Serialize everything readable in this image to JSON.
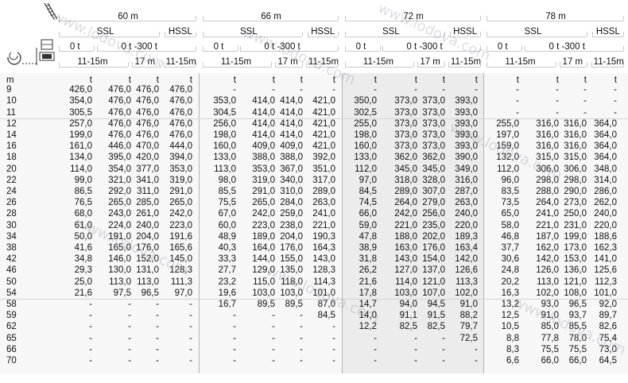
{
  "header": {
    "groups": [
      {
        "label": "60 m",
        "ssl": "SSL",
        "hssl": "HSSL",
        "ballast_a": "0 t",
        "ballast_b": "0 t -300 t",
        "r1": "11-15m",
        "r2": "17 m",
        "r3": "11-15m"
      },
      {
        "label": "66 m",
        "ssl": "SSL",
        "hssl": "HSSL",
        "ballast_a": "0 t",
        "ballast_b": "0 t -300 t",
        "r1": "11-15m",
        "r2": "17 m",
        "r3": "11-15m"
      },
      {
        "label": "72 m",
        "ssl": "SSL",
        "hssl": "HSSL",
        "ballast_a": "0 t",
        "ballast_b": "0 t -300 t",
        "r1": "11-15m",
        "r2": "17 m",
        "r3": "11-15m"
      },
      {
        "label": "78 m",
        "ssl": "SSL",
        "hssl": "HSSL",
        "ballast_a": "0 t",
        "ballast_b": "0 t -300 t",
        "r1": "11-15m",
        "r2": "17 m",
        "r3": "11-15m"
      }
    ]
  },
  "unit_row": {
    "m": "m",
    "t": "t"
  },
  "rows": [
    {
      "m": "9",
      "v": [
        "426,0",
        "476,0",
        "476,0",
        "476,0",
        "-",
        "-",
        "-",
        "-",
        "-",
        "-",
        "-",
        "-",
        "-",
        "-",
        "-",
        "-"
      ]
    },
    {
      "m": "10",
      "v": [
        "354,0",
        "476,0",
        "476,0",
        "476,0",
        "353,0",
        "414,0",
        "414,0",
        "421,0",
        "350,0",
        "373,0",
        "373,0",
        "393,0",
        "-",
        "-",
        "-",
        "-"
      ]
    },
    {
      "m": "11",
      "v": [
        "305,5",
        "476,0",
        "476,0",
        "476,0",
        "304,5",
        "414,0",
        "414,0",
        "421,0",
        "302,5",
        "373,0",
        "373,0",
        "393,0",
        "-",
        "-",
        "-",
        "-"
      ]
    },
    {
      "m": "12",
      "v": [
        "257,0",
        "476,0",
        "476,0",
        "476,0",
        "256,0",
        "414,0",
        "414,0",
        "421,0",
        "255,0",
        "373,0",
        "373,0",
        "393,0",
        "255,0",
        "316,0",
        "316,0",
        "364,0"
      ]
    },
    {
      "m": "14",
      "v": [
        "199,0",
        "476,0",
        "476,0",
        "476,0",
        "198,0",
        "414,0",
        "414,0",
        "421,0",
        "198,0",
        "373,0",
        "373,0",
        "393,0",
        "197,0",
        "316,0",
        "316,0",
        "364,0"
      ]
    },
    {
      "m": "16",
      "v": [
        "161,0",
        "446,0",
        "470,0",
        "444,0",
        "160,0",
        "409,0",
        "409,0",
        "421,0",
        "160,0",
        "373,0",
        "373,0",
        "393,0",
        "159,0",
        "316,0",
        "316,0",
        "364,0"
      ]
    },
    {
      "m": "18",
      "v": [
        "134,0",
        "395,0",
        "420,0",
        "394,0",
        "133,0",
        "388,0",
        "388,0",
        "392,0",
        "133,0",
        "362,0",
        "362,0",
        "390,0",
        "132,0",
        "315,0",
        "315,0",
        "364,0"
      ]
    },
    {
      "m": "20",
      "v": [
        "114,0",
        "354,0",
        "377,0",
        "353,0",
        "113,0",
        "353,0",
        "367,0",
        "351,0",
        "112,0",
        "345,0",
        "345,0",
        "349,0",
        "112,0",
        "306,0",
        "306,0",
        "348,0"
      ]
    },
    {
      "m": "22",
      "v": [
        "99,0",
        "321,0",
        "341,0",
        "319,0",
        "98,0",
        "319,0",
        "340,0",
        "317,0",
        "97,0",
        "318,0",
        "328,0",
        "316,0",
        "96,0",
        "298,0",
        "298,0",
        "314,0"
      ]
    },
    {
      "m": "24",
      "v": [
        "86,5",
        "292,0",
        "311,0",
        "291,0",
        "85,5",
        "291,0",
        "310,0",
        "289,0",
        "84,5",
        "289,0",
        "307,0",
        "287,0",
        "83,5",
        "288,0",
        "290,0",
        "286,0"
      ]
    },
    {
      "m": "26",
      "v": [
        "76,5",
        "265,0",
        "285,0",
        "265,0",
        "75,5",
        "265,0",
        "284,0",
        "263,0",
        "74,5",
        "264,0",
        "279,0",
        "263,0",
        "73,5",
        "264,0",
        "273,0",
        "262,0"
      ]
    },
    {
      "m": "28",
      "v": [
        "68,0",
        "243,0",
        "261,0",
        "242,0",
        "67,0",
        "242,0",
        "259,0",
        "241,0",
        "66,0",
        "242,0",
        "256,0",
        "240,0",
        "65,0",
        "241,0",
        "250,0",
        "240,0"
      ]
    },
    {
      "m": "30",
      "v": [
        "61,0",
        "224,0",
        "240,0",
        "223,0",
        "60,0",
        "223,0",
        "238,0",
        "221,0",
        "59,0",
        "221,0",
        "235,0",
        "220,0",
        "58,0",
        "221,0",
        "231,0",
        "220,0"
      ]
    },
    {
      "m": "34",
      "v": [
        "50,0",
        "191,0",
        "204,0",
        "191,6",
        "48,9",
        "189,0",
        "204,0",
        "190,3",
        "47,8",
        "188,0",
        "202,0",
        "189,3",
        "46,8",
        "187,0",
        "199,0",
        "188,6"
      ]
    },
    {
      "m": "38",
      "v": [
        "41,6",
        "165,0",
        "176,0",
        "165,6",
        "40,3",
        "164,0",
        "176,0",
        "164,3",
        "38,9",
        "163,0",
        "176,0",
        "163,4",
        "37,7",
        "162,0",
        "173,0",
        "162,3"
      ]
    },
    {
      "m": "42",
      "v": [
        "34,8",
        "146,0",
        "152,0",
        "145,0",
        "33,3",
        "144,0",
        "155,0",
        "143,0",
        "31,8",
        "143,0",
        "154,0",
        "142,0",
        "30,6",
        "142,0",
        "153,0",
        "141,0"
      ]
    },
    {
      "m": "46",
      "v": [
        "29,3",
        "130,0",
        "131,0",
        "128,3",
        "27,7",
        "129,0",
        "135,0",
        "128,3",
        "26,2",
        "127,0",
        "137,0",
        "126,6",
        "24,8",
        "126,0",
        "136,0",
        "125,6"
      ]
    },
    {
      "m": "50",
      "v": [
        "25,0",
        "113,0",
        "113,0",
        "111,3",
        "23,2",
        "115,0",
        "118,0",
        "114,3",
        "21,6",
        "114,0",
        "121,0",
        "113,3",
        "20,2",
        "113,0",
        "121,0",
        "112,3"
      ]
    },
    {
      "m": "54",
      "v": [
        "21,6",
        "97,5",
        "96,5",
        "97,0",
        "19,6",
        "103,0",
        "103,0",
        "101,0",
        "17,8",
        "103,0",
        "107,0",
        "102,0",
        "16,3",
        "102,0",
        "108,0",
        "101,0"
      ]
    },
    {
      "m": "58",
      "v": [
        "-",
        "-",
        "-",
        "-",
        "16,7",
        "89,5",
        "89,5",
        "87,0",
        "14,7",
        "94,0",
        "94,5",
        "91,0",
        "13,2",
        "93,0",
        "96,5",
        "92,0"
      ]
    },
    {
      "m": "59",
      "v": [
        "-",
        "-",
        "-",
        "-",
        "-",
        "-",
        "-",
        "84,5",
        "14,0",
        "91,1",
        "91,5",
        "88,2",
        "12,5",
        "91,0",
        "93,7",
        "89,7"
      ]
    },
    {
      "m": "62",
      "v": [
        "-",
        "-",
        "-",
        "-",
        "-",
        "-",
        "-",
        "-",
        "12,2",
        "82,5",
        "82,5",
        "79,7",
        "10,5",
        "85,0",
        "85,5",
        "82,6"
      ]
    },
    {
      "m": "65",
      "v": [
        "-",
        "-",
        "-",
        "-",
        "-",
        "-",
        "-",
        "-",
        "-",
        "-",
        "-",
        "72,5",
        "8,8",
        "77,8",
        "78,0",
        "75,4"
      ]
    },
    {
      "m": "66",
      "v": [
        "-",
        "-",
        "-",
        "-",
        "-",
        "-",
        "-",
        "-",
        "-",
        "-",
        "-",
        "-",
        "8,3",
        "75,5",
        "75,5",
        "73,0"
      ]
    },
    {
      "m": "70",
      "v": [
        "-",
        "-",
        "-",
        "-",
        "-",
        "-",
        "-",
        "-",
        "-",
        "-",
        "-",
        "-",
        "6,6",
        "66,0",
        "66,0",
        "64,5"
      ]
    }
  ],
  "watermark": "www.lodova.com"
}
